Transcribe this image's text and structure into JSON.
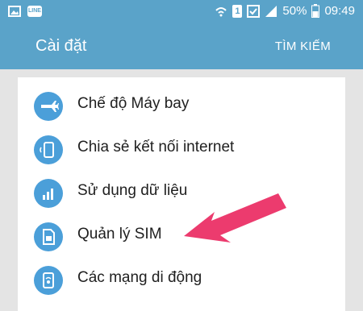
{
  "status_bar": {
    "battery": "50%",
    "time": "09:49",
    "line_badge": "LINE",
    "sim_badge": "1"
  },
  "app_bar": {
    "title": "Cài đặt",
    "search_label": "TÌM KIẾM"
  },
  "settings": [
    {
      "label": "Chế độ Máy bay",
      "icon": "airplane-icon"
    },
    {
      "label": "Chia sẻ kết nối internet",
      "icon": "hotspot-icon"
    },
    {
      "label": "Sử dụng dữ liệu",
      "icon": "data-usage-icon"
    },
    {
      "label": "Quản lý SIM",
      "icon": "sim-card-icon"
    },
    {
      "label": "Các mạng di động",
      "icon": "mobile-network-icon"
    }
  ],
  "colors": {
    "app_bar": "#5aa3c9",
    "icon_bg": "#4b9fd9",
    "annotation_arrow": "#ec3b6e"
  }
}
